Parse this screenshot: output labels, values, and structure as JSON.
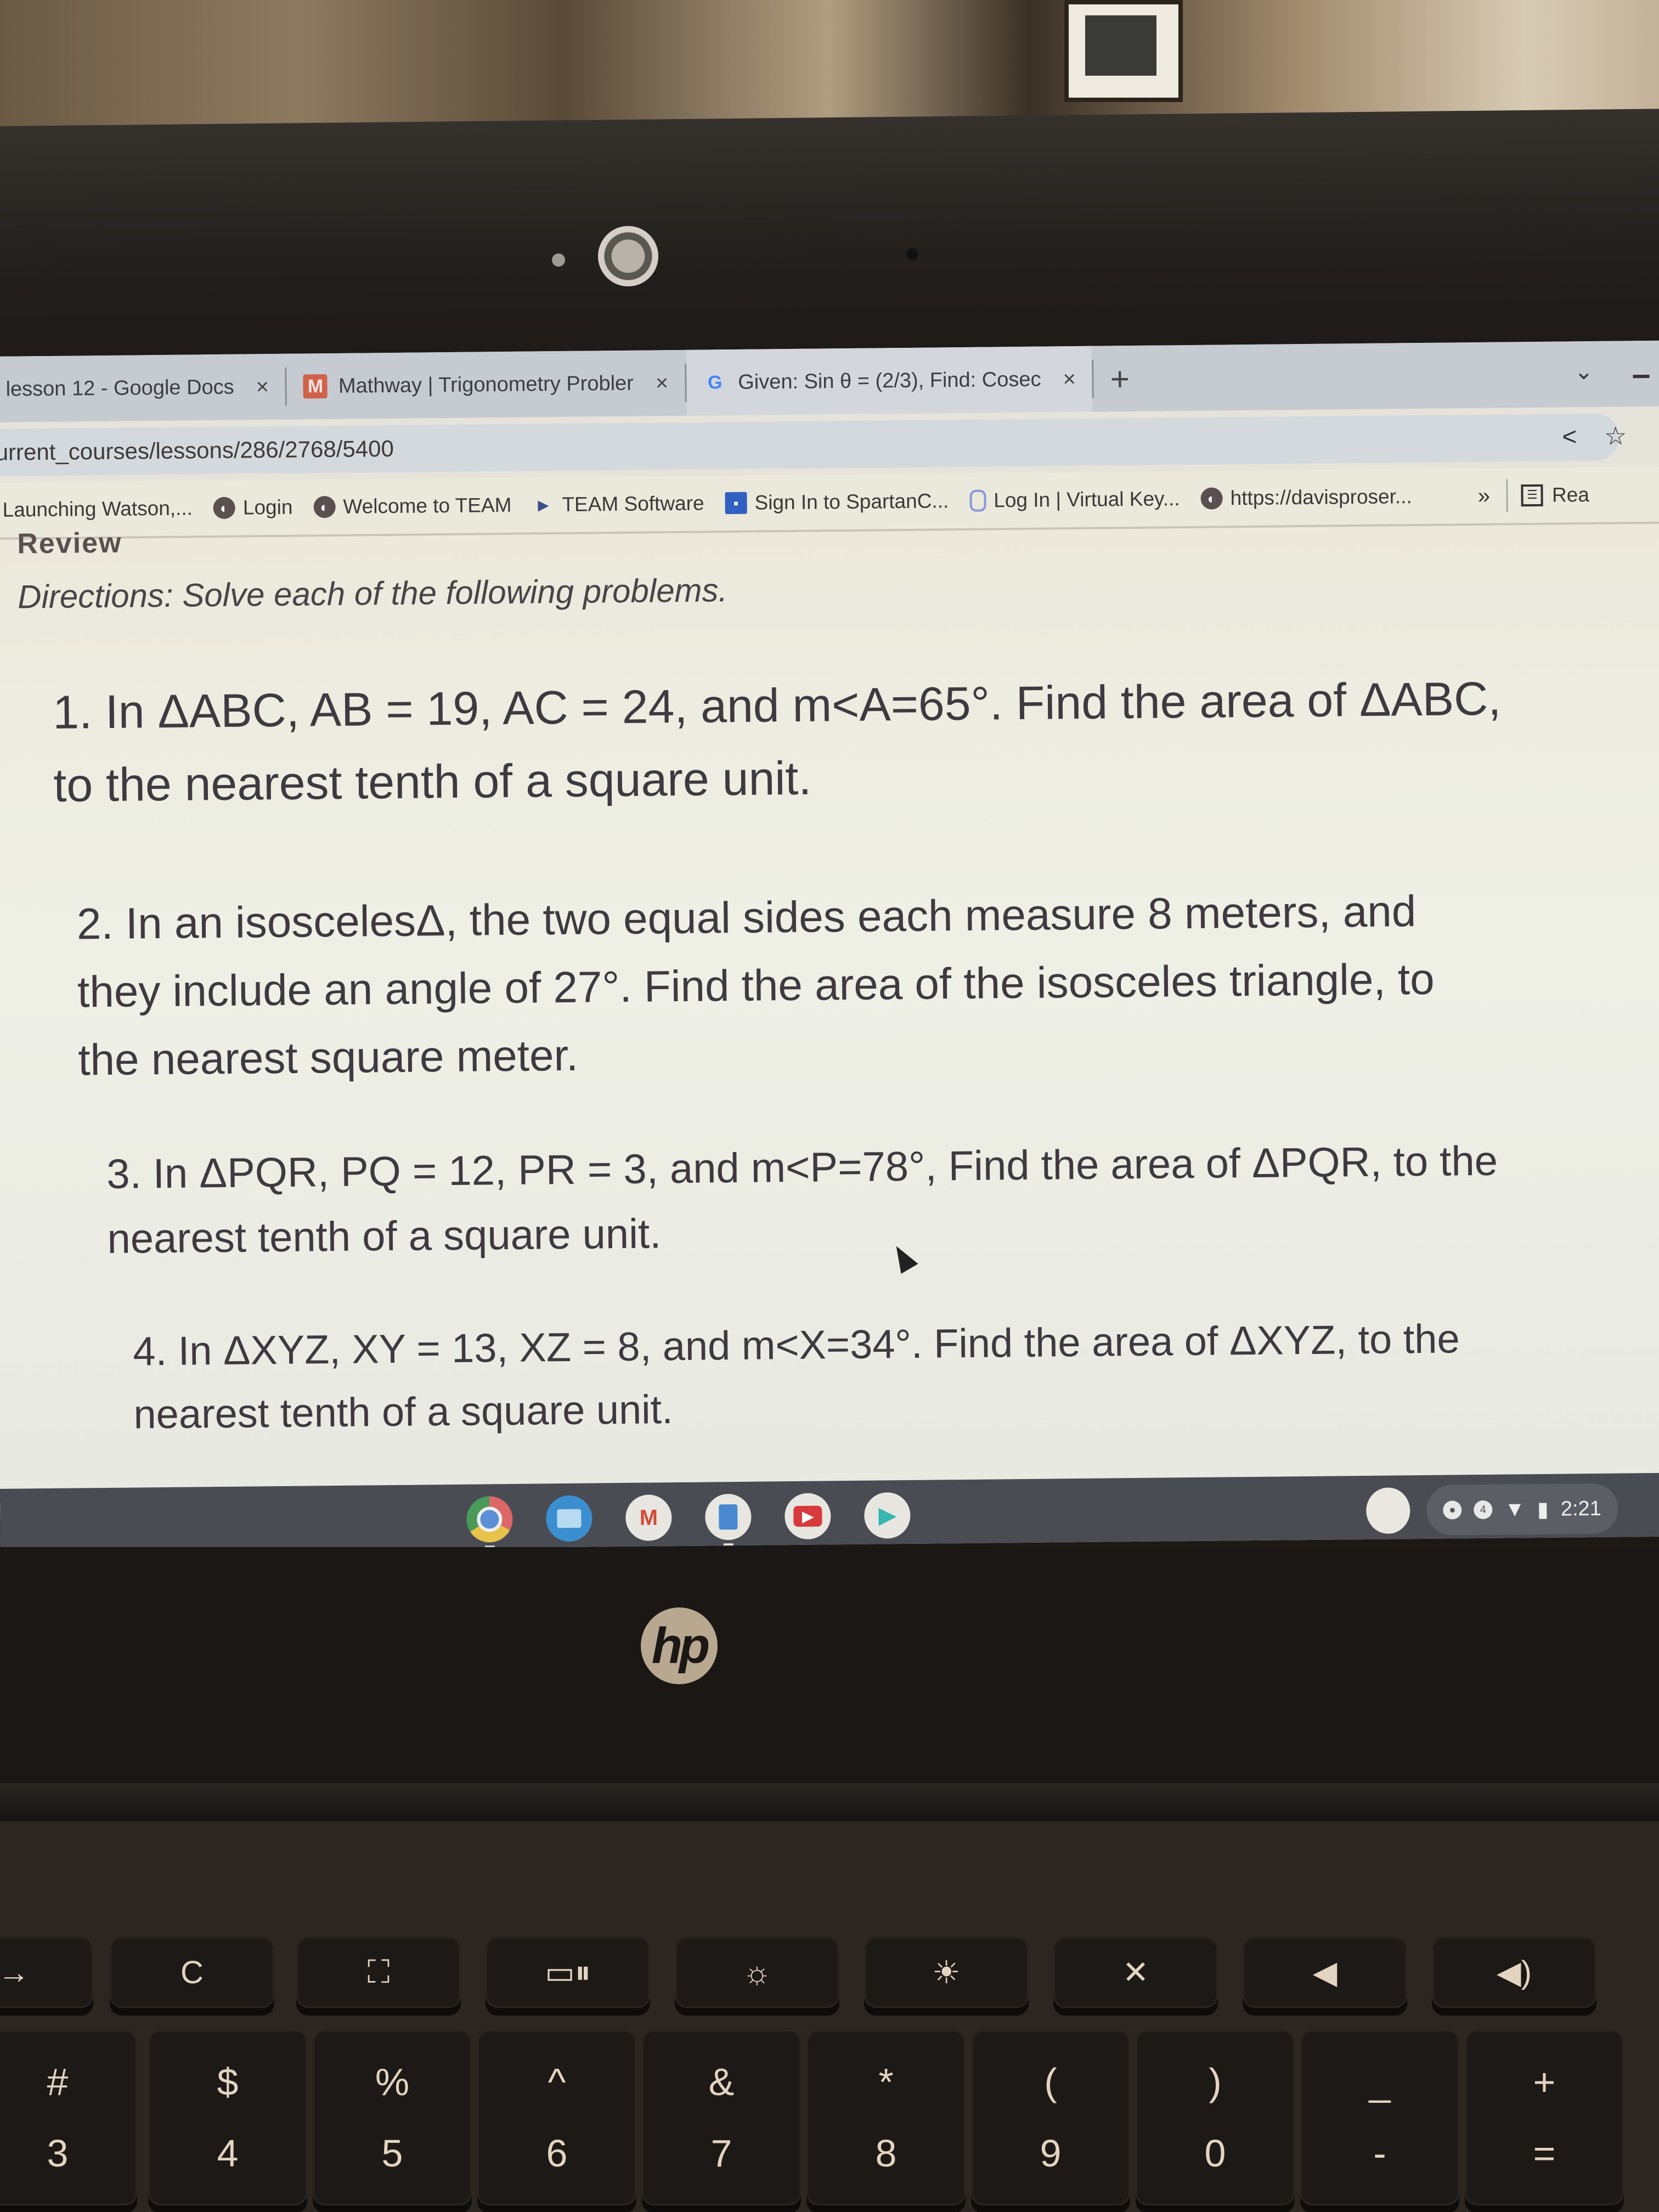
{
  "browser": {
    "tabs": [
      {
        "title": "lesson 12 - Google Docs",
        "icon": "google-docs-icon",
        "close": "×"
      },
      {
        "title": "Mathway | Trigonometry Probler",
        "icon": "mathway-icon",
        "icon_glyph": "M",
        "close": "×"
      },
      {
        "title": "Given: Sin θ = (2/3), Find: Cosec",
        "icon": "google-icon",
        "icon_glyph": "G",
        "close": "×"
      }
    ],
    "new_tab": "+",
    "tab_search": "⌄",
    "url": "urrent_courses/lessons/286/2768/5400",
    "omnibar_icons": {
      "share": "<",
      "bookmark": "☆"
    },
    "bookmarks": [
      {
        "label": "Launching Watson,...",
        "icon": "none"
      },
      {
        "label": "Login",
        "icon": "globe-icon"
      },
      {
        "label": "Welcome to TEAM",
        "icon": "globe-icon"
      },
      {
        "label": "TEAM Software",
        "icon": "team-icon"
      },
      {
        "label": "Sign In to SpartanC...",
        "icon": "spartan-icon"
      },
      {
        "label": "Log In | Virtual Key...",
        "icon": "virtual-key-icon"
      },
      {
        "label": "https://davisproser...",
        "icon": "globe-icon"
      }
    ],
    "bookmarks_overflow": "»",
    "reading_list": "Rea"
  },
  "page": {
    "heading": "Review",
    "directions": "Directions: Solve each of the following problems.",
    "problems": [
      "1. In ΔABC, AB = 19, AC = 24, and m<A=65°. Find the area of ΔABC, to the nearest tenth of a square unit.",
      "2. In an isoscelesΔ, the two equal sides each measure 8 meters, and they include an angle of 27°. Find the area of the isosceles triangle, to the nearest square meter.",
      "3. In ΔPQR, PQ = 12, PR = 3, and m<P=78°, Find the area of ΔPQR, to the nearest tenth of a square unit.",
      "4. In ΔXYZ, XY = 13, XZ = 8, and m<X=34°. Find the area of ΔXYZ, to the nearest tenth of a square unit."
    ]
  },
  "shelf": {
    "apps": [
      "Chrome",
      "Files",
      "Gmail",
      "Docs",
      "YouTube",
      "Play Store"
    ],
    "gmail_glyph": "M",
    "play_glyph": "▶",
    "clock": "2:21",
    "status_icons": [
      "notification-icon",
      "update-icon",
      "wifi-icon",
      "battery-icon"
    ],
    "wifi_glyph": "▼",
    "battery_glyph": "▮"
  },
  "laptop": {
    "brand": "hp",
    "function_keys": [
      "→",
      "C",
      "⛶",
      "▭⏸",
      "☼",
      "☀",
      "✕",
      "◀",
      "◀)"
    ],
    "number_keys": [
      {
        "top": "#",
        "bottom": "3"
      },
      {
        "top": "$",
        "bottom": "4"
      },
      {
        "top": "%",
        "bottom": "5"
      },
      {
        "top": "^",
        "bottom": "6"
      },
      {
        "top": "&",
        "bottom": "7"
      },
      {
        "top": "*",
        "bottom": "8"
      },
      {
        "top": "(",
        "bottom": "9"
      },
      {
        "top": ")",
        "bottom": "0"
      },
      {
        "top": "_",
        "bottom": "-"
      },
      {
        "top": "+",
        "bottom": "="
      }
    ]
  }
}
